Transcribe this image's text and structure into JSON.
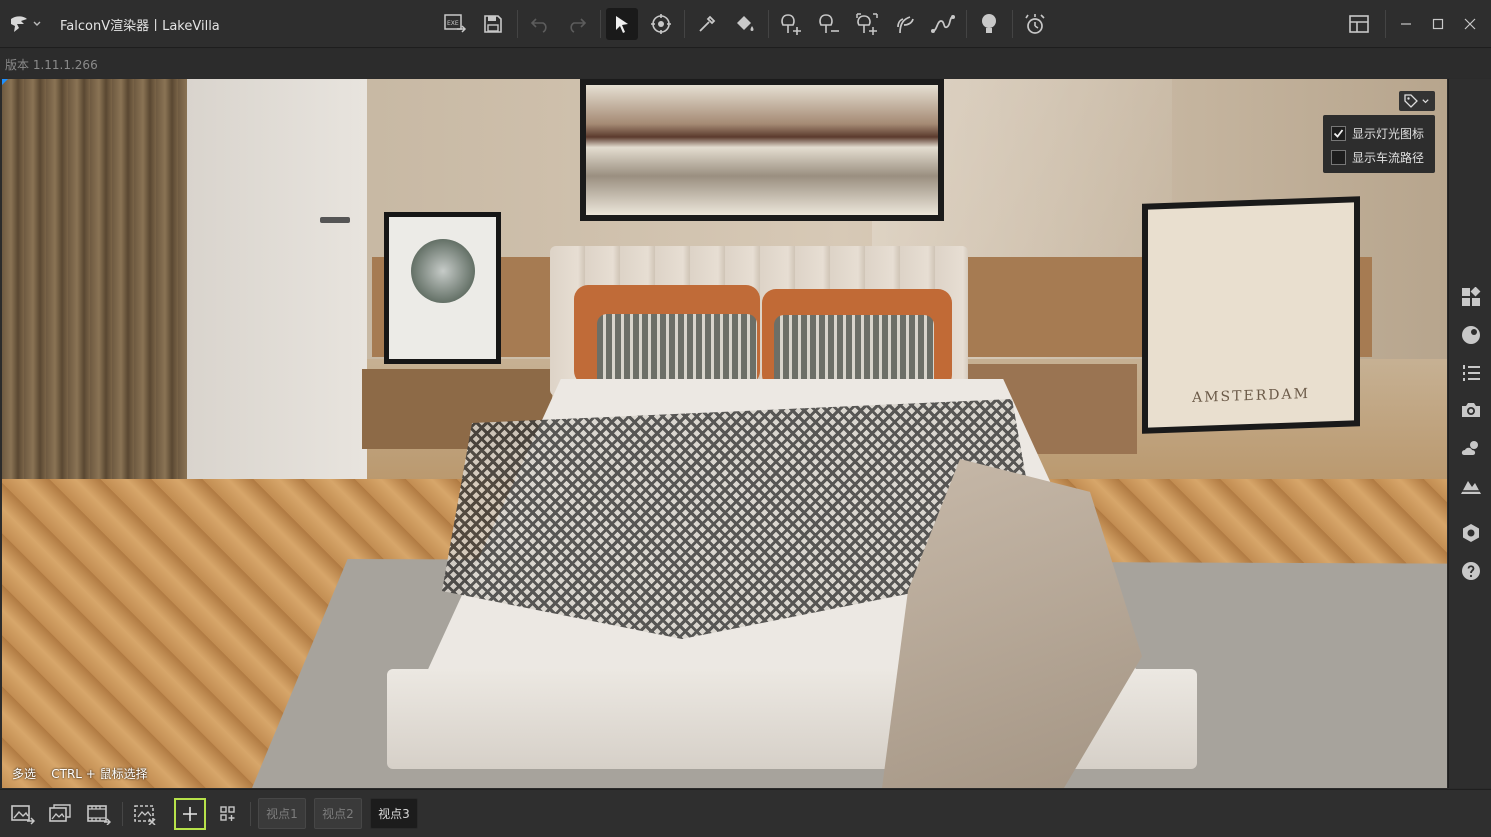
{
  "app": {
    "title": "FalconV渲染器丨LakeVilla",
    "version": "版本 1.11.1.266"
  },
  "toolbar": {
    "icons": [
      "export-exe-icon",
      "save-icon",
      "undo-icon",
      "redo-icon",
      "select-arrow-icon",
      "orbit-icon",
      "eyedropper-icon",
      "paint-bucket-icon",
      "add-tree-icon",
      "remove-tree-icon",
      "tree-brush-icon",
      "plant-icon",
      "path-curve-icon",
      "light-bulb-icon",
      "time-of-day-icon"
    ],
    "active": "select-arrow-icon"
  },
  "window_controls": [
    "layout-icon",
    "minimize-icon",
    "maximize-icon",
    "close-icon"
  ],
  "viewport": {
    "hint": "多选    CTRL + 鼠标选择",
    "painting_text": "AMSTERDAM",
    "overlay": {
      "options": [
        {
          "label": "显示灯光图标",
          "checked": true
        },
        {
          "label": "显示车流路径",
          "checked": false
        }
      ]
    }
  },
  "sidebar": {
    "icons": [
      "assets-icon",
      "material-icon",
      "layers-icon",
      "camera-icon",
      "weather-icon",
      "terrain-icon",
      "settings-icon",
      "help-icon"
    ]
  },
  "bottom": {
    "tools": [
      "render-image-icon",
      "render-batch-icon",
      "render-video-icon",
      "crop-region-icon",
      "add-viewpoint-icon",
      "grid-add-icon"
    ],
    "viewpoints": [
      "视点1",
      "视点2",
      "视点3"
    ],
    "active_viewpoint": "视点3"
  },
  "colors": {
    "accent_green": "#b7e24a",
    "accent_blue": "#1e90ff",
    "background": "#2b2b2b"
  }
}
